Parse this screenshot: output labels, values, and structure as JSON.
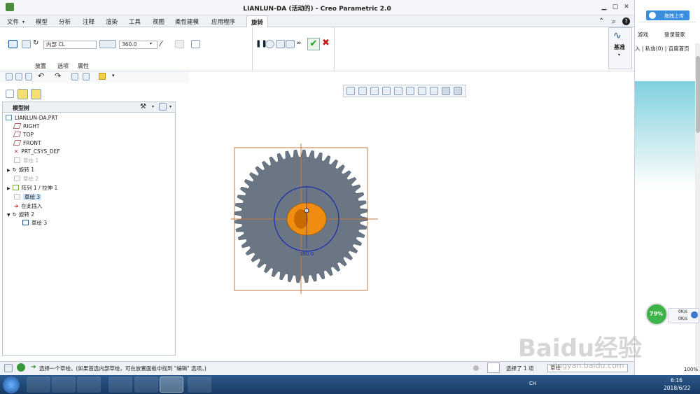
{
  "window": {
    "title": "LIANLUN-DA (活动的) - Creo Parametric 2.0",
    "min": "▁",
    "max": "▢",
    "close": "✕"
  },
  "menu_tabs": [
    "文件",
    "模型",
    "分析",
    "注释",
    "渲染",
    "工具",
    "视图",
    "柔性建模",
    "应用程序",
    "旋转"
  ],
  "ribbon": {
    "sketch_field": "内部 CL",
    "angle_value": "360.0",
    "datum_label": "基准",
    "subtabs": [
      "放置",
      "选项",
      "属性"
    ]
  },
  "left_panel": {
    "header": "模型树",
    "tree": [
      {
        "label": "LIANLUN-DA.PRT",
        "state": "normal"
      },
      {
        "label": "RIGHT",
        "state": "normal"
      },
      {
        "label": "TOP",
        "state": "normal"
      },
      {
        "label": "FRONT",
        "state": "normal"
      },
      {
        "label": "PRT_CSYS_DEF",
        "state": "normal"
      },
      {
        "label": "草绘 1",
        "state": "grey"
      },
      {
        "label": "旋转 1",
        "state": "normal"
      },
      {
        "label": "草绘 2",
        "state": "grey"
      },
      {
        "label": "阵列 1 / 拉伸 1",
        "state": "normal"
      },
      {
        "label": "草绘 3",
        "state": "selected"
      },
      {
        "label": "在此插入",
        "state": "normal"
      },
      {
        "label": "旋转 2",
        "state": "normal"
      },
      {
        "label": "草绘 3",
        "state": "normal"
      }
    ]
  },
  "viewport": {
    "dimension_label": "360.0"
  },
  "status": {
    "message": "选择一个草绘。(如果首选内部草绘，可在放置面板中找到 \"编辑\" 选项。)",
    "selected": "选择了 1 项",
    "filter": "草绘"
  },
  "browser": {
    "upload": "拖拽上传",
    "game": "游戏",
    "login": "登录管家",
    "links": "入 | 私信(0) | 百度首页",
    "speed_percent": "79%",
    "up_speed": "0K/s",
    "down_speed": "0K/s",
    "zoom": "100%"
  },
  "taskbar": {
    "time": "6:16",
    "date": "2018/6/22",
    "ime": "CH"
  },
  "watermark": {
    "text": "Baidu经验",
    "url": "jingyan.baidu.com"
  }
}
